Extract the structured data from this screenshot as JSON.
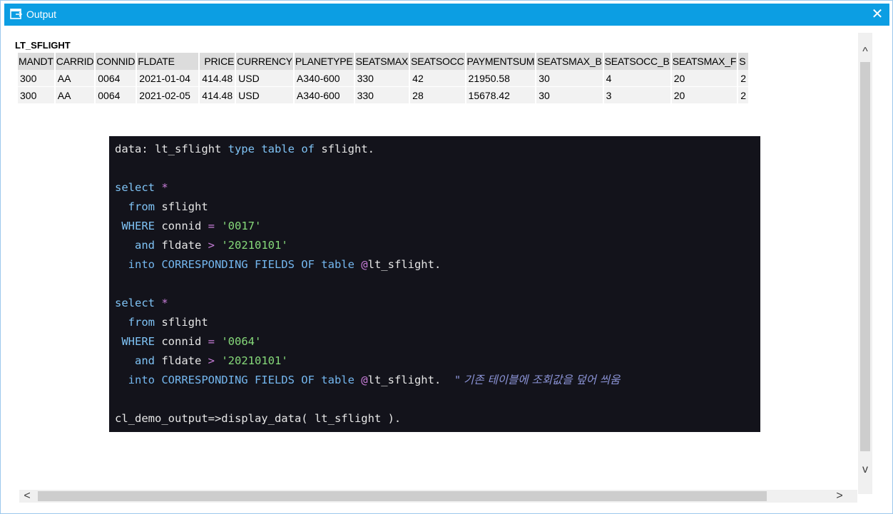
{
  "window": {
    "title": "Output",
    "close_glyph": "✕",
    "title_icon": "output-window-icon"
  },
  "output": {
    "table_name": "LT_SFLIGHT",
    "columns": [
      "MANDT",
      "CARRID",
      "CONNID",
      "FLDATE",
      "PRICE",
      "CURRENCY",
      "PLANETYPE",
      "SEATSMAX",
      "SEATSOCC",
      "PAYMENTSUM",
      "SEATSMAX_B",
      "SEATSOCC_B",
      "SEATSMAX_F",
      "S"
    ],
    "rows": [
      [
        "300",
        "AA",
        "0064",
        "2021-01-04",
        "414.48",
        "USD",
        "A340-600",
        "330",
        "42",
        "21950.58",
        "30",
        "4",
        "20",
        "2"
      ],
      [
        "300",
        "AA",
        "0064",
        "2021-02-05",
        "414.48",
        "USD",
        "A340-600",
        "330",
        "28",
        "15678.42",
        "30",
        "3",
        "20",
        "2"
      ]
    ]
  },
  "scrollbars": {
    "up_glyph": "^",
    "down_glyph": "v",
    "left_glyph": "<",
    "right_glyph": ">"
  },
  "code": {
    "l1": {
      "a": "data: lt_sflight ",
      "b": "type",
      "c": " ",
      "d": "table",
      "e": " ",
      "f": "of",
      "g": " sflight."
    },
    "l3": {
      "a": "select",
      "b": " *"
    },
    "l4": {
      "a": "  from",
      "b": " sflight"
    },
    "l5": {
      "a": " WHERE",
      "b": " connid ",
      "c": "=",
      "d": " ",
      "e": "'0017'"
    },
    "l6": {
      "a": "   and",
      "b": " fldate ",
      "c": ">",
      "d": " ",
      "e": "'20210101'"
    },
    "l7": {
      "a": "  into CORRESPONDING FIELDS OF table",
      "b": " ",
      "c": "@",
      "d": "lt_sflight."
    },
    "l9": {
      "a": "select",
      "b": " *"
    },
    "l10": {
      "a": "  from",
      "b": " sflight"
    },
    "l11": {
      "a": " WHERE",
      "b": " connid ",
      "c": "=",
      "d": " ",
      "e": "'0064'"
    },
    "l12": {
      "a": "   and",
      "b": " fldate ",
      "c": ">",
      "d": " ",
      "e": "'20210101'"
    },
    "l13": {
      "a": "  into CORRESPONDING FIELDS OF table",
      "b": " ",
      "c": "@",
      "d": "lt_sflight.",
      "e": "    \" 기존 테이블에 조회값을 덮어 씌움"
    },
    "l15": {
      "a": "cl_demo_output=>display_data( lt_sflight )."
    }
  }
}
